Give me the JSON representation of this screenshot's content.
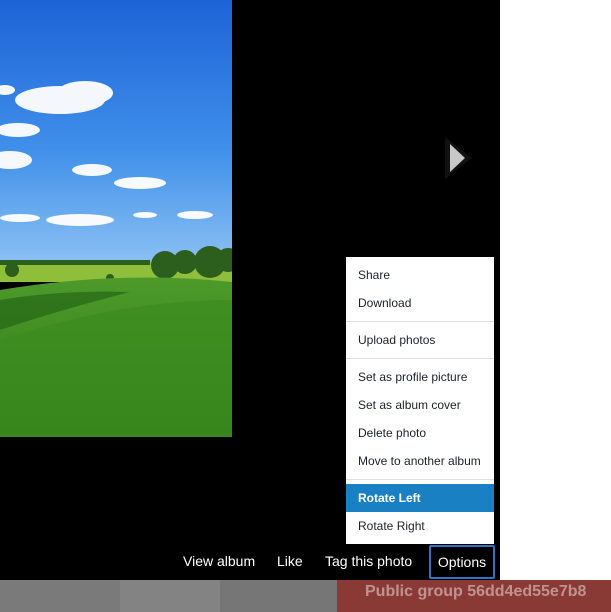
{
  "viewer": {
    "photo_alt": "Green grass field under blue sky with clouds",
    "next_icon": "play-arrow-icon"
  },
  "menu": {
    "groups": [
      [
        "Share",
        "Download"
      ],
      [
        "Upload photos"
      ],
      [
        "Set as profile picture",
        "Set as album cover",
        "Delete photo",
        "Move to another album"
      ],
      [
        "Rotate Left",
        "Rotate Right"
      ]
    ],
    "highlighted": "Rotate Left"
  },
  "actions": {
    "view_album": "View album",
    "like": "Like",
    "tag_photo": "Tag this photo",
    "options": "Options"
  },
  "background": {
    "group_label": "Public group 56dd4ed55e7b8"
  },
  "colors": {
    "viewer_bg": "#000000",
    "highlight": "#1a80c4",
    "options_border": "#2e74c6",
    "menu_bg": "#ffffff"
  }
}
